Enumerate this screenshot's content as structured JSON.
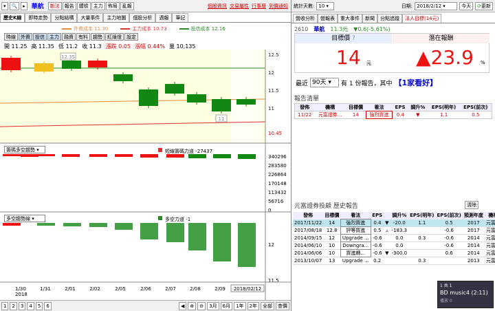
{
  "toolbar": {
    "stock": "華航",
    "buttons": [
      {
        "label": "新法",
        "red": true
      },
      {
        "label": "報告",
        "red": false
      },
      {
        "label": "體檢",
        "red": false
      },
      {
        "label": "主力",
        "red": false
      },
      {
        "label": "佈局",
        "red": false
      },
      {
        "label": "亂報",
        "red": false
      }
    ],
    "links": [
      "個股資訊",
      "交易屬性",
      "行事曆",
      "到價通知"
    ]
  },
  "tabs": [
    "歷史K線",
    "即時走勢",
    "分點結構",
    "大量事件",
    "主力地圖",
    "個股分析",
    "週報",
    "筆記"
  ],
  "legend": [
    {
      "label": "外資成本 11.30",
      "color": "#e88a3a"
    },
    {
      "label": "主力成本 10.73",
      "color": "#d33"
    },
    {
      "label": "投信成本 12.16",
      "color": "#2a8a2a"
    }
  ],
  "indicator_buttons": [
    "時線",
    "外資",
    "投信",
    "主力",
    "融資",
    "有料",
    "趨勢",
    "紅綠燈",
    "設定"
  ],
  "ohlc": {
    "open": "開 11.25",
    "high": "高 11.35",
    "low": "低 11.2",
    "close": "收 11.3",
    "chg": "漲跌 0.05",
    "pct": "漲幅 0.44%",
    "vol": "量 10,135"
  },
  "price_axis": [
    "12.5",
    "12",
    "11.5",
    "11",
    "10.45"
  ],
  "candle_tags": {
    "high": "12.35",
    "low": "11"
  },
  "panel1": {
    "selector": "籌碼多空趨勢",
    "title": "短線籌碼力道 -27437",
    "axis": [
      "340296",
      "283580",
      "226864",
      "170148",
      "113432",
      "56716",
      "0"
    ]
  },
  "panel2": {
    "selector": "多空趨勢線",
    "title": "多空力道 -1",
    "axis": [
      "12",
      "11.5"
    ]
  },
  "dates": [
    "1/30",
    "1/31",
    "2/01",
    "2/02",
    "2/05",
    "2/06",
    "2/07",
    "2/08",
    "2/09",
    "2018/02/12"
  ],
  "year": "2018",
  "pages": [
    "1",
    "2",
    "3",
    "4",
    "5",
    "6"
  ],
  "zoom": [
    "3月",
    "6月",
    "1年",
    "2年",
    "全部",
    "查價"
  ],
  "right": {
    "toolbar": {
      "count_label": "統計天數:",
      "count": "10",
      "date_label": "日期:",
      "date": "2018/2/12",
      "today": "今天",
      "refresh": "更新"
    },
    "tabs": [
      "營收分析",
      "營報表",
      "重大事件",
      "新聞",
      "分點追蹤",
      "法人目標(14元)"
    ],
    "quote": {
      "code": "2610",
      "name": "華航",
      "price": "11.3元",
      "change": "▼0.6(-5.61%)"
    },
    "target_label": "目標價",
    "target_q": "?",
    "target_value": "14",
    "target_unit": "元",
    "potential_label": "潛在報酬",
    "potential_value": "▲23.9",
    "potential_unit": "%",
    "recent": {
      "prefix": "最近",
      "days": "90天",
      "text": "有 1 份報告，其中",
      "highlight": "【1家看好】"
    },
    "report_title": "報告清單",
    "report_headers": [
      "發佈",
      "機構",
      "目標價",
      "看法",
      "EPS",
      "調升%",
      "EPS(明年)",
      "EPS(前次)"
    ],
    "report_rows": [
      [
        "11/22",
        "元富證券...",
        "14",
        "強烈買進",
        "0.4",
        "▼",
        "-20.0",
        "1.1",
        "0.5"
      ]
    ],
    "history_title": "元富證券投顧 歷史報告",
    "clear": "清除",
    "history_headers": [
      "發佈",
      "目標價",
      "看法",
      "EPS",
      "",
      "調升%",
      "EPS(明年)",
      "EPS(前次)",
      "預測年度",
      "機構"
    ],
    "history_rows": [
      [
        "2017/11/22",
        "14",
        "強烈買進",
        "0.4",
        "▼",
        "-20.0",
        "1.1",
        "0.5",
        "2017",
        "元富證"
      ],
      [
        "2017/08/18",
        "12.8",
        "評等買進",
        "0.5",
        "▵",
        "-183.3",
        "",
        "-0.6",
        "2017",
        "元富證"
      ],
      [
        "2014/09/15",
        "12",
        "Upgrade ...",
        "-0.6",
        "",
        "0.0",
        "0.3",
        "-0.6",
        "2014",
        "元富證"
      ],
      [
        "2014/06/10",
        "10",
        "Downgra...",
        "-0.6",
        "",
        "0.0",
        "",
        "-0.6",
        "2014",
        "元富證"
      ],
      [
        "2014/06/06",
        "10",
        "買進轉...",
        "-0.6",
        "▼",
        "-300.0",
        "",
        "0.6",
        "2014",
        "元富證"
      ],
      [
        "2013/10/07",
        "13",
        "Upgrade ...",
        "0.2",
        "",
        "",
        "0.3",
        "",
        "2013",
        "元富證"
      ]
    ],
    "popup": {
      "top": "1 共 1",
      "title": "BD music4 (2:11)",
      "sub": "播放 0"
    }
  },
  "colors": {
    "up": "#ee1111",
    "down": "#118811",
    "yellow": "#f0c020"
  }
}
